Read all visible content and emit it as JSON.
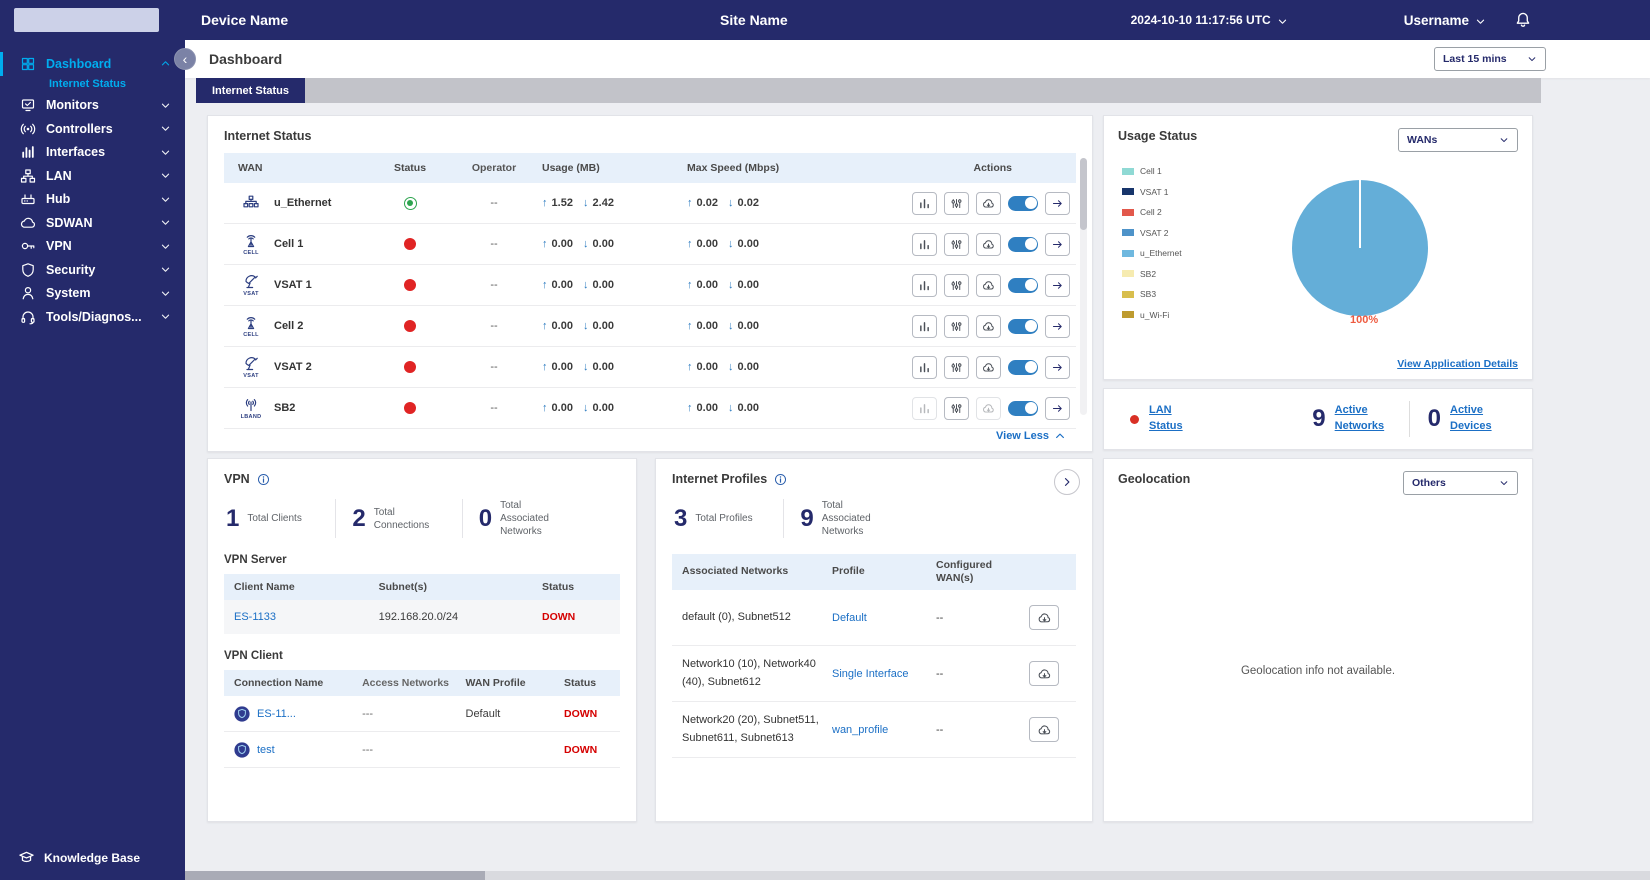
{
  "colors": {
    "navy": "#252A6B",
    "cyan": "#00ADEF",
    "link": "#1B6FC5",
    "red": "#D93025",
    "green": "#2da44e",
    "pie": "#64AED8",
    "pie_label": "#EE5B40",
    "table_head": "#E7F0FA"
  },
  "topbar": {
    "device_name": "Device Name",
    "site_name": "Site Name",
    "timestamp": "2024-10-10 11:17:56 UTC",
    "username": "Username"
  },
  "sidebar": {
    "items": [
      {
        "label": "Dashboard",
        "icon": "dashboard",
        "active": true,
        "expanded": true,
        "sub": [
          "Internet Status"
        ]
      },
      {
        "label": "Monitors",
        "icon": "monitors"
      },
      {
        "label": "Controllers",
        "icon": "controllers"
      },
      {
        "label": "Interfaces",
        "icon": "interfaces"
      },
      {
        "label": "LAN",
        "icon": "lan"
      },
      {
        "label": "Hub",
        "icon": "hub"
      },
      {
        "label": "SDWAN",
        "icon": "sdwan"
      },
      {
        "label": "VPN",
        "icon": "vpn"
      },
      {
        "label": "Security",
        "icon": "security"
      },
      {
        "label": "System",
        "icon": "system"
      },
      {
        "label": "Tools/Diagnos...",
        "icon": "tools"
      }
    ],
    "footer": "Knowledge Base"
  },
  "header": {
    "title": "Dashboard",
    "time_filter": "Last 15 mins",
    "active_tab": "Internet Status"
  },
  "internet_status": {
    "title": "Internet Status",
    "columns": [
      "WAN",
      "Status",
      "Operator",
      "Usage (MB)",
      "Max Speed (Mbps)",
      "Actions"
    ],
    "rows": [
      {
        "name": "u_Ethernet",
        "icon": "ethernet",
        "icon_label": "",
        "status": "up",
        "operator": "--",
        "usage_up": "1.52",
        "usage_down": "2.42",
        "speed_up": "0.02",
        "speed_down": "0.02",
        "disabled_actions": []
      },
      {
        "name": "Cell 1",
        "icon": "cell",
        "icon_label": "CELL",
        "status": "down",
        "operator": "--",
        "usage_up": "0.00",
        "usage_down": "0.00",
        "speed_up": "0.00",
        "speed_down": "0.00",
        "disabled_actions": []
      },
      {
        "name": "VSAT 1",
        "icon": "vsat",
        "icon_label": "VSAT",
        "status": "down",
        "operator": "--",
        "usage_up": "0.00",
        "usage_down": "0.00",
        "speed_up": "0.00",
        "speed_down": "0.00",
        "disabled_actions": []
      },
      {
        "name": "Cell 2",
        "icon": "cell",
        "icon_label": "CELL",
        "status": "down",
        "operator": "--",
        "usage_up": "0.00",
        "usage_down": "0.00",
        "speed_up": "0.00",
        "speed_down": "0.00",
        "disabled_actions": []
      },
      {
        "name": "VSAT 2",
        "icon": "vsat",
        "icon_label": "VSAT",
        "status": "down",
        "operator": "--",
        "usage_up": "0.00",
        "usage_down": "0.00",
        "speed_up": "0.00",
        "speed_down": "0.00",
        "disabled_actions": []
      },
      {
        "name": "SB2",
        "icon": "lband",
        "icon_label": "LBAND",
        "status": "down",
        "operator": "--",
        "usage_up": "0.00",
        "usage_down": "0.00",
        "speed_up": "0.00",
        "speed_down": "0.00",
        "disabled_actions": [
          "chart",
          "cloud"
        ]
      }
    ],
    "view_less": "View Less"
  },
  "usage_status": {
    "title": "Usage Status",
    "dropdown": "WANs",
    "legend": [
      {
        "label": "Cell 1",
        "color": "#8FD9D4"
      },
      {
        "label": "VSAT 1",
        "color": "#17356B"
      },
      {
        "label": "Cell 2",
        "color": "#E2584B"
      },
      {
        "label": "VSAT 2",
        "color": "#4E93C9"
      },
      {
        "label": "u_Ethernet",
        "color": "#6FB8DF"
      },
      {
        "label": "SB2",
        "color": "#F6EBB0"
      },
      {
        "label": "SB3",
        "color": "#D8BE4D"
      },
      {
        "label": "u_Wi-Fi",
        "color": "#BE9B2F"
      }
    ],
    "pie": {
      "series": [
        {
          "label": "u_Ethernet",
          "value": 100
        }
      ],
      "label": "100%"
    },
    "link": "View Application Details"
  },
  "lan_status": {
    "lan_label": "LAN Status",
    "networks_value": "9",
    "networks_label": "Active Networks",
    "devices_value": "0",
    "devices_label": "Active Devices"
  },
  "vpn": {
    "title": "VPN",
    "stats": [
      {
        "value": "1",
        "label": "Total Clients"
      },
      {
        "value": "2",
        "label": "Total Connections"
      },
      {
        "value": "0",
        "label": "Total Associated Networks"
      }
    ],
    "server": {
      "title": "VPN Server",
      "columns": [
        "Client Name",
        "Subnet(s)",
        "Status"
      ],
      "rows": [
        {
          "name": "ES-1133",
          "subnets": "192.168.20.0/24",
          "status": "DOWN"
        }
      ]
    },
    "client": {
      "title": "VPN Client",
      "columns": [
        "Connection Name",
        "Access Networks",
        "WAN Profile",
        "Status"
      ],
      "rows": [
        {
          "name": "ES-11...",
          "access": "---",
          "profile": "Default",
          "status": "DOWN"
        },
        {
          "name": "test",
          "access": "---",
          "profile": "",
          "status": "DOWN"
        }
      ]
    }
  },
  "internet_profiles": {
    "title": "Internet Profiles",
    "stats": [
      {
        "value": "3",
        "label": "Total Profiles"
      },
      {
        "value": "9",
        "label": "Total Associated Networks"
      }
    ],
    "columns": [
      "Associated Networks",
      "Profile",
      "Configured WAN(s)",
      ""
    ],
    "rows": [
      {
        "networks": "default (0), Subnet512",
        "profile": "Default",
        "wans": "--"
      },
      {
        "networks": "Network10 (10), Network40 (40), Subnet612",
        "profile": "Single Interface",
        "wans": "--"
      },
      {
        "networks": "Network20 (20), Subnet511, Subnet611, Subnet613",
        "profile": "wan_profile",
        "wans": "--"
      }
    ]
  },
  "geolocation": {
    "title": "Geolocation",
    "dropdown": "Others",
    "message": "Geolocation info not available."
  }
}
